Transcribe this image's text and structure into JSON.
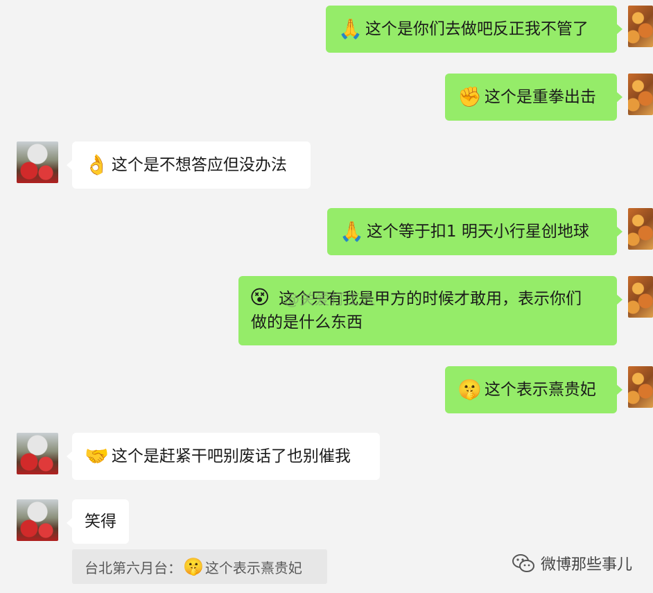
{
  "messages": [
    {
      "side": "mine",
      "emoji": "🙏",
      "text": "这个是你们去做吧反正我不管了"
    },
    {
      "side": "mine",
      "emoji": "✊",
      "text": "这个是重拳出击"
    },
    {
      "side": "theirs",
      "emoji": "👌",
      "text": "这个是不想答应但没办法"
    },
    {
      "side": "mine",
      "emoji": "🙏",
      "text": "这个等于扣1 明天小行星创地球"
    },
    {
      "side": "mine",
      "emoji": "😵",
      "text_line1": "这个只有我是甲方的时候才敢用，表示你们",
      "text_line2": "做的是什么东西"
    },
    {
      "side": "mine",
      "emoji": "🤫",
      "text": "这个表示熹贵妃"
    },
    {
      "side": "theirs",
      "emoji": "🤝",
      "text": "这个是赶紧干吧别废话了也别催我"
    },
    {
      "side": "theirs",
      "emoji": "",
      "text": "笑得"
    }
  ],
  "quote": {
    "sender": "台北第六月台：",
    "emoji": "🤫",
    "text": "这个表示熹贵妃"
  },
  "watermark": {
    "text": "@关爱打工人"
  },
  "footer": {
    "account": "微博那些事儿",
    "icon": "wechat-icon"
  },
  "colors": {
    "mine_bubble": "#95ec69",
    "theirs_bubble": "#ffffff",
    "background": "#f3f3f3"
  }
}
